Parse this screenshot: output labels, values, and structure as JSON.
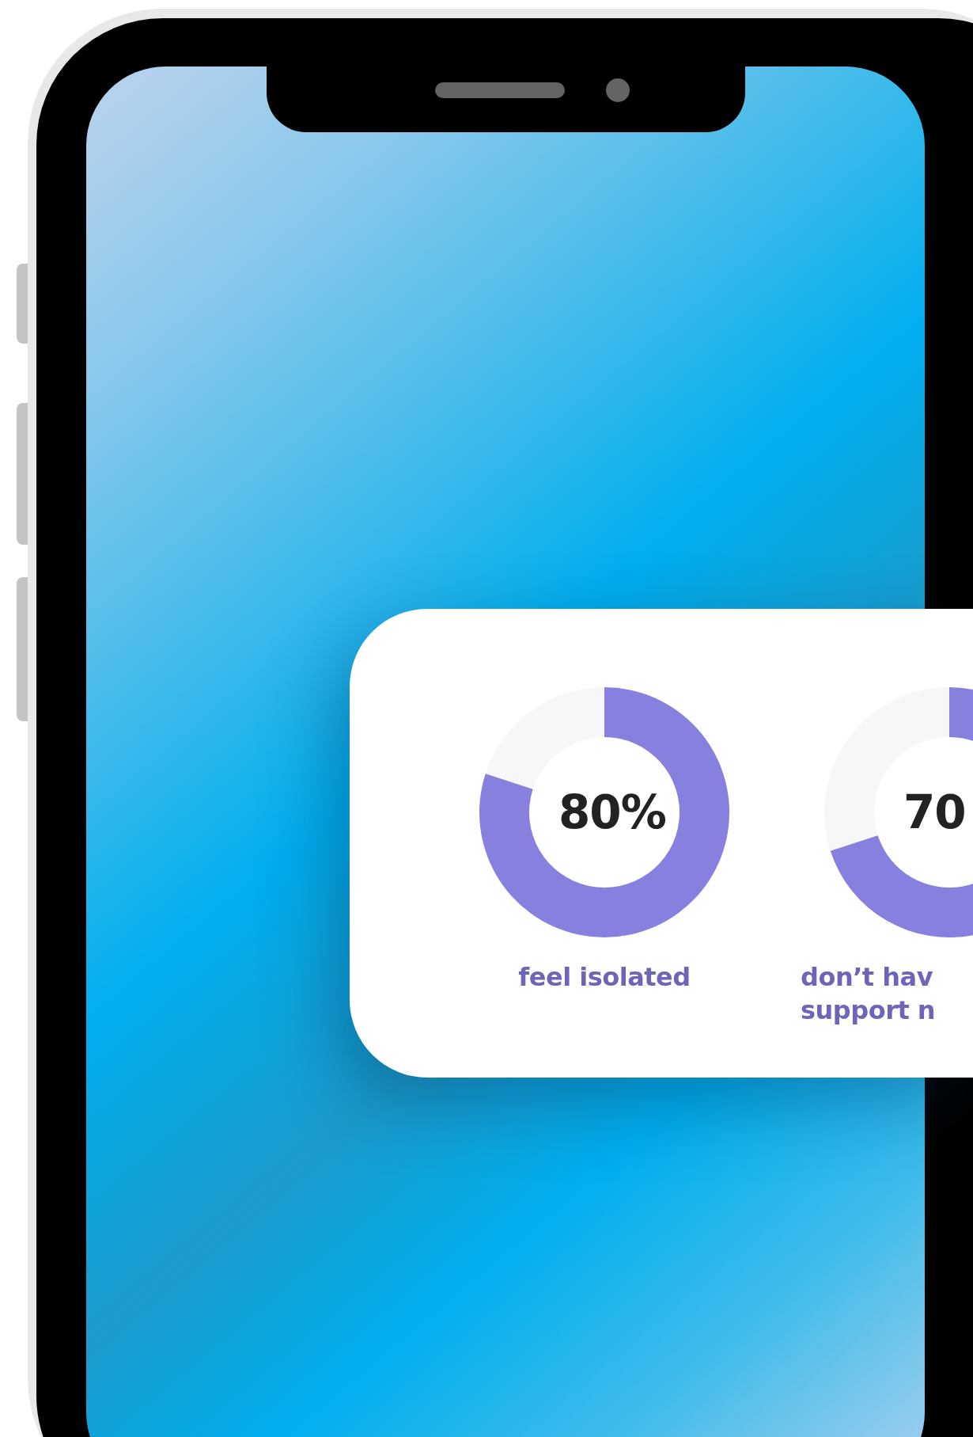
{
  "stats": [
    {
      "value": "80%",
      "chart_data": {
        "type": "donut",
        "values": [
          80,
          20
        ]
      },
      "label_lines": [
        "feel isolated"
      ]
    },
    {
      "value": "70",
      "chart_data": {
        "type": "donut",
        "values": [
          70,
          30
        ]
      },
      "label_lines": [
        "don’t hav",
        "support n"
      ]
    }
  ]
}
